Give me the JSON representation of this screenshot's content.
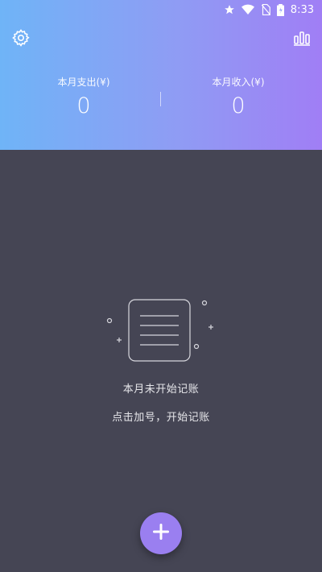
{
  "status_bar": {
    "time": "8:33",
    "icons": [
      "star-icon",
      "wifi-icon",
      "no-sim-icon",
      "battery-icon"
    ]
  },
  "toolbar": {
    "settings_icon": "gear-icon",
    "stats_icon": "bar-chart-icon"
  },
  "summary": {
    "expense_label": "本月支出(¥)",
    "expense_value": "0",
    "income_label": "本月收入(¥)",
    "income_value": "0"
  },
  "empty_state": {
    "illustration": "notebook-icon",
    "title": "本月未开始记账",
    "hint": "点击加号，开始记账"
  },
  "fab": {
    "icon": "plus-icon"
  },
  "colors": {
    "header_gradient_start": "#6fb4f7",
    "header_gradient_end": "#a07ef5",
    "background": "#454554",
    "fab": "#9a7ff0"
  }
}
